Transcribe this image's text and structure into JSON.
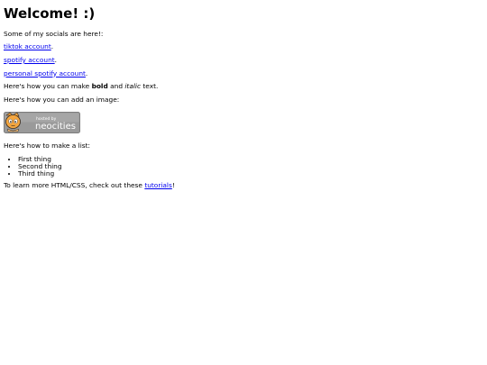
{
  "page": {
    "title": "Welcome! :)",
    "intro": "Some of my socials are here!:",
    "links": [
      {
        "label": "tiktok account",
        "suffix": "."
      },
      {
        "label": "spotify account",
        "suffix": "."
      },
      {
        "label": "personal spotify account",
        "suffix": "."
      }
    ],
    "bold_line": {
      "prefix": "Here's how you can make ",
      "bold": "bold",
      "middle": " and ",
      "italic": "italic",
      "suffix": " text."
    },
    "image_line": "Here's how you can add an image:",
    "badge": {
      "line1": "hosted by",
      "line2": "neocities"
    },
    "list_intro": "Here's how to make a list:",
    "list_items": [
      "First thing",
      "Second thing",
      "Third thing"
    ],
    "footer": {
      "prefix": "To learn more HTML/CSS, check out these ",
      "link": "tutorials",
      "suffix": "!"
    }
  },
  "colors": {
    "link": "#0000ee",
    "badge_bg": "#9a9a9a",
    "badge_text": "#ffffff",
    "mascot_orange": "#f4a640"
  }
}
